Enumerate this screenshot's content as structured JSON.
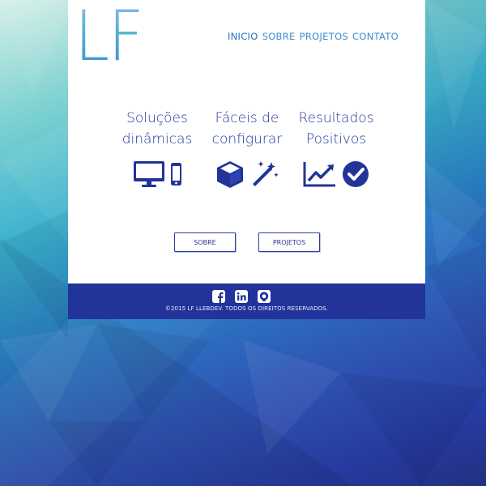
{
  "logo": {
    "text": "LF"
  },
  "nav": {
    "items": [
      {
        "label": "INICIO",
        "active": true
      },
      {
        "label": "SOBRE",
        "active": false
      },
      {
        "label": "PROJETOS",
        "active": false
      },
      {
        "label": "CONTATO",
        "active": false
      }
    ]
  },
  "features": [
    {
      "line1": "Soluções",
      "line2": "dinâmicas",
      "icons": [
        "desktop-icon",
        "mobile-icon"
      ]
    },
    {
      "line1": "Fáceis de",
      "line2": "configurar",
      "icons": [
        "cube-icon",
        "magic-wand-icon"
      ]
    },
    {
      "line1": "Resultados",
      "line2": "Positivos",
      "icons": [
        "line-chart-icon",
        "check-circle-icon"
      ]
    }
  ],
  "buttons": {
    "sobre": "SOBRE",
    "projetos": "PROJETOS"
  },
  "footer": {
    "social": [
      "facebook-icon",
      "linkedin-icon",
      "github-icon"
    ],
    "copyright": "©2015 LF LLEBDEV. TODOS OS DIREITOS RESERVADOS."
  },
  "colors": {
    "primary": "#223399",
    "nav": "#3d8dcf",
    "background_top": "#7fd3d1",
    "background_bottom": "#23307f"
  }
}
